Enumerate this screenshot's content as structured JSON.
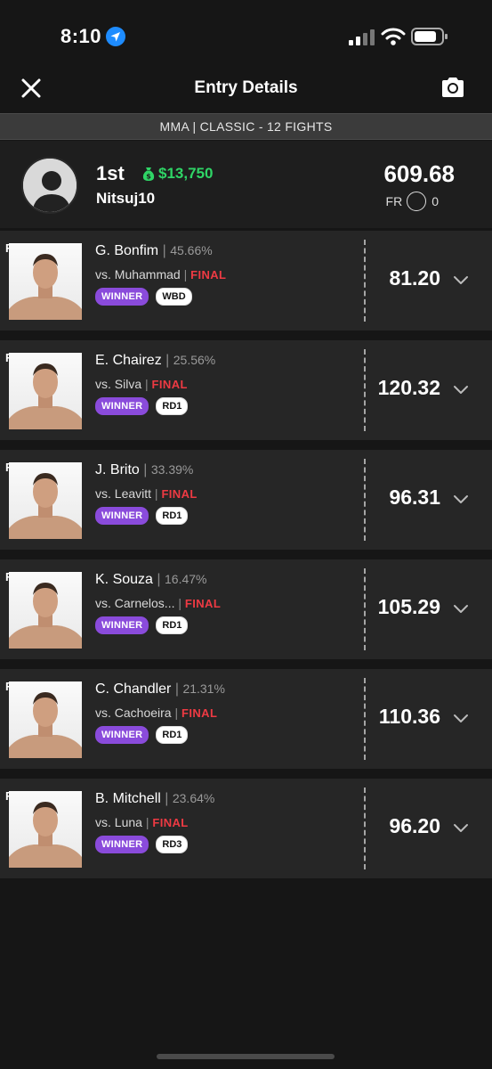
{
  "status_bar": {
    "time": "8:10"
  },
  "header": {
    "title": "Entry Details"
  },
  "contest": {
    "label": "MMA | CLASSIC - 12 FIGHTS"
  },
  "summary": {
    "rank": "1st",
    "winnings": "$13,750",
    "username": "Nitsuj10",
    "total_points": "609.68",
    "fr_label": "FR",
    "fr_value": "0"
  },
  "fighters": [
    {
      "flag": "F",
      "name": "G. Bonfim",
      "ownership": "45.66%",
      "opponent": "vs. Muhammad",
      "status": "FINAL",
      "result": "WINNER",
      "method": "WBD",
      "points": "81.20"
    },
    {
      "flag": "F",
      "name": "E. Chairez",
      "ownership": "25.56%",
      "opponent": "vs. Silva",
      "status": "FINAL",
      "result": "WINNER",
      "method": "RD1",
      "points": "120.32"
    },
    {
      "flag": "F",
      "name": "J. Brito",
      "ownership": "33.39%",
      "opponent": "vs. Leavitt",
      "status": "FINAL",
      "result": "WINNER",
      "method": "RD1",
      "points": "96.31"
    },
    {
      "flag": "F",
      "name": "K. Souza",
      "ownership": "16.47%",
      "opponent": "vs. Carnelos...",
      "status": "FINAL",
      "result": "WINNER",
      "method": "RD1",
      "points": "105.29"
    },
    {
      "flag": "F",
      "name": "C. Chandler",
      "ownership": "21.31%",
      "opponent": "vs. Cachoeira",
      "status": "FINAL",
      "result": "WINNER",
      "method": "RD1",
      "points": "110.36"
    },
    {
      "flag": "F",
      "name": "B. Mitchell",
      "ownership": "23.64%",
      "opponent": "vs. Luna",
      "status": "FINAL",
      "result": "WINNER",
      "method": "RD3",
      "points": "96.20"
    }
  ],
  "colors": {
    "accent_green": "#2fd566",
    "final_red": "#ee3a43",
    "winner_purple": "#8a4bdb"
  },
  "icons": [
    "location-arrow-icon",
    "signal-icon",
    "wifi-icon",
    "battery-icon",
    "close-icon",
    "camera-icon",
    "money-bag-icon",
    "chevron-down-icon"
  ]
}
